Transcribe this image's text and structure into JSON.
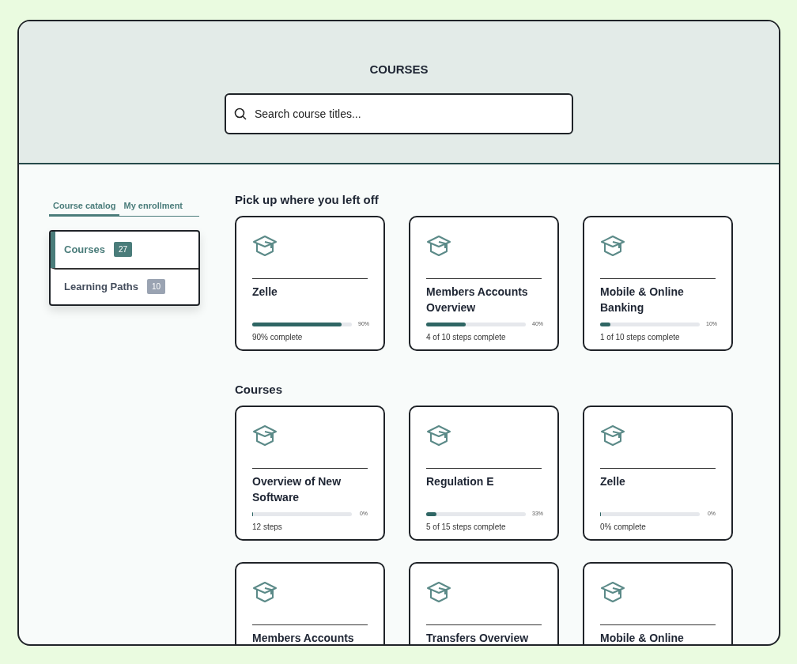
{
  "header": {
    "title": "COURSES",
    "search": {
      "placeholder": "Search course titles..."
    }
  },
  "tabs": [
    {
      "label": "Course catalog",
      "selected": true
    },
    {
      "label": "My enrollment",
      "selected": false
    }
  ],
  "sidebar": {
    "items": [
      {
        "label": "Courses",
        "count": "27",
        "selected": true
      },
      {
        "label": "Learning Paths",
        "count": "10",
        "selected": false
      }
    ]
  },
  "sections": [
    {
      "heading": "Pick up where you left off",
      "cards": [
        {
          "title": "Zelle",
          "level": 0.9,
          "percent": "90%",
          "caption": "90% complete"
        },
        {
          "title": "Members Accounts Overview",
          "level": 0.4,
          "percent": "40%",
          "caption": "4 of 10 steps complete"
        },
        {
          "title": "Mobile & Online Banking",
          "level": 0.1,
          "percent": "10%",
          "caption": "1 of 10 steps complete"
        }
      ]
    },
    {
      "heading": "Courses",
      "cards": [
        {
          "title": "Overview of New Software",
          "level": 0,
          "percent": "0%",
          "caption": "12 steps"
        },
        {
          "title": "Regulation E",
          "level": 0.1,
          "percent": "33%",
          "caption": "5 of 15 steps complete"
        },
        {
          "title": "Zelle",
          "level": 0,
          "percent": "0%",
          "caption": "0% complete"
        },
        {
          "title": "Members Accounts"
        },
        {
          "title": "Transfers Overview"
        },
        {
          "title": "Mobile & Online"
        }
      ]
    }
  ]
}
